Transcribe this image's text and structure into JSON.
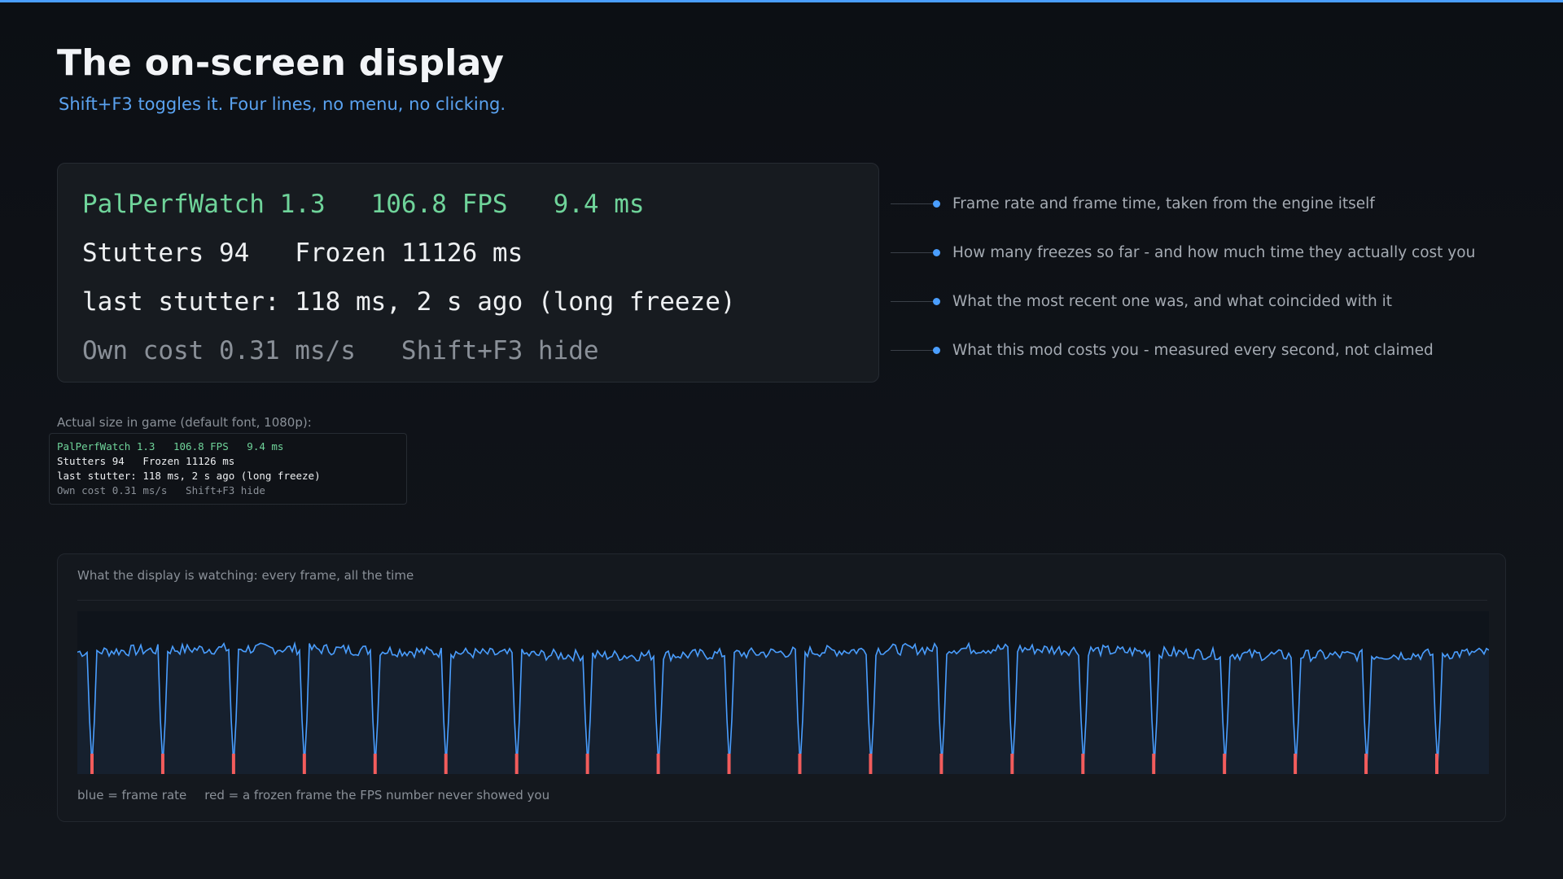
{
  "header": {
    "title": "The on-screen display",
    "subtitle": "Shift+F3 toggles it. Four lines, no menu, no clicking."
  },
  "osd": {
    "line1": "PalPerfWatch 1.3   106.8 FPS   9.4 ms",
    "line2": "Stutters 94   Frozen 11126 ms",
    "line3": "last stutter: 118 ms, 2 s ago (long freeze)",
    "line4": "Own cost 0.31 ms/s   Shift+F3 hide"
  },
  "callouts": [
    "Frame rate and frame time, taken from the engine itself",
    "How many freezes so far - and how much time they actually cost you",
    "What the most recent one was, and what coincided with it",
    "What this mod costs you - measured every second, not claimed"
  ],
  "actual_size_label": "Actual size in game (default font, 1080p):",
  "chart": {
    "title": "What the display is watching: every frame, all the time",
    "legend_blue": "blue = frame rate",
    "legend_red": "red = a frozen frame the FPS number never showed you"
  },
  "colors": {
    "accent": "#4a9eff",
    "osd_green": "#6fd49a",
    "freeze_red": "#f25c5c"
  },
  "chart_data": {
    "type": "line",
    "baseline_fps": 107,
    "freeze_count": 20,
    "freeze_fps": 8
  }
}
